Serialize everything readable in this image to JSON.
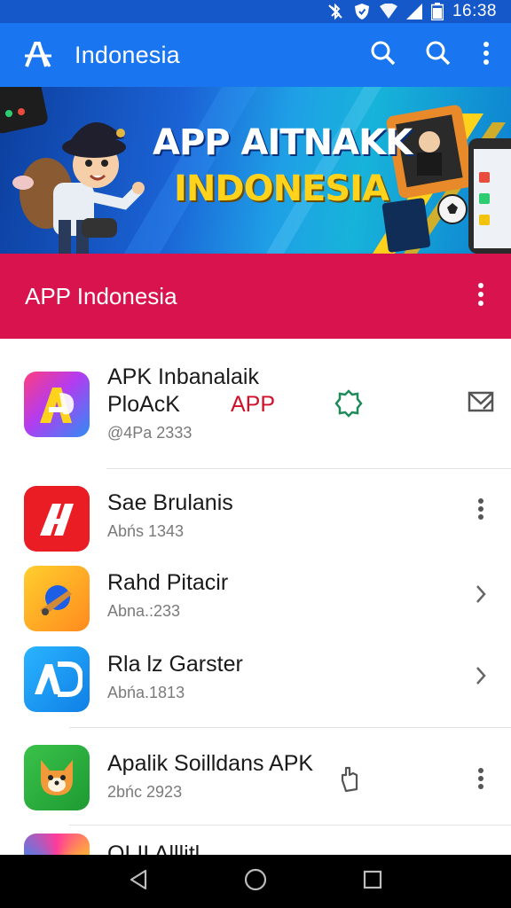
{
  "status_bar": {
    "time": "16:38",
    "icons": [
      "bluetooth-muted-icon",
      "shield-icon",
      "wifi-icon",
      "signal-icon",
      "battery-icon"
    ]
  },
  "app_bar": {
    "title": "Indonesia",
    "logo_icon": "app-logo-icon",
    "actions": [
      "search-icon",
      "search-icon",
      "more-vert-icon"
    ]
  },
  "banner": {
    "line1": "APP AITNAKK",
    "line2": "INDONESIA"
  },
  "section": {
    "title": "APP Indonesia"
  },
  "list": {
    "items": [
      {
        "title_line1": "APK Inbanalaik",
        "title_line2": "PloAcK",
        "tag": "APP",
        "sub": "@4Pa 2333",
        "icon": "app-a-icon",
        "mid_icon": "gear-badge-icon",
        "trailing": "share-icon"
      },
      {
        "title": "Sae Brulanis",
        "sub": "Abńs 1343",
        "icon": "app-n-icon",
        "trailing": "more-vert-icon"
      },
      {
        "title": "Rahd Pitacir",
        "sub": "Abna.:233",
        "icon": "app-rocket-icon",
        "trailing": "chevron-right-icon"
      },
      {
        "title": "Rla lz Garster",
        "sub": "Abńa.1813",
        "icon": "app-ad-icon",
        "trailing": "chevron-right-icon"
      },
      {
        "title": "Apalik Soilldans APK",
        "sub": "2bńc 2923",
        "icon": "app-fox-icon",
        "mid_icon": "hand-icon",
        "trailing": "more-vert-icon"
      },
      {
        "title": "OLII Alllitl",
        "icon": "app-circle-icon",
        "trailing": "more-vert-icon"
      }
    ]
  },
  "nav_bar": {
    "buttons": [
      "back-icon",
      "home-icon",
      "recents-icon"
    ]
  },
  "colors": {
    "status_bar": "#1558c9",
    "app_bar": "#1976f0",
    "section_header": "#d8134d",
    "tag_red": "#d0102a",
    "nav_bar": "#000000"
  }
}
